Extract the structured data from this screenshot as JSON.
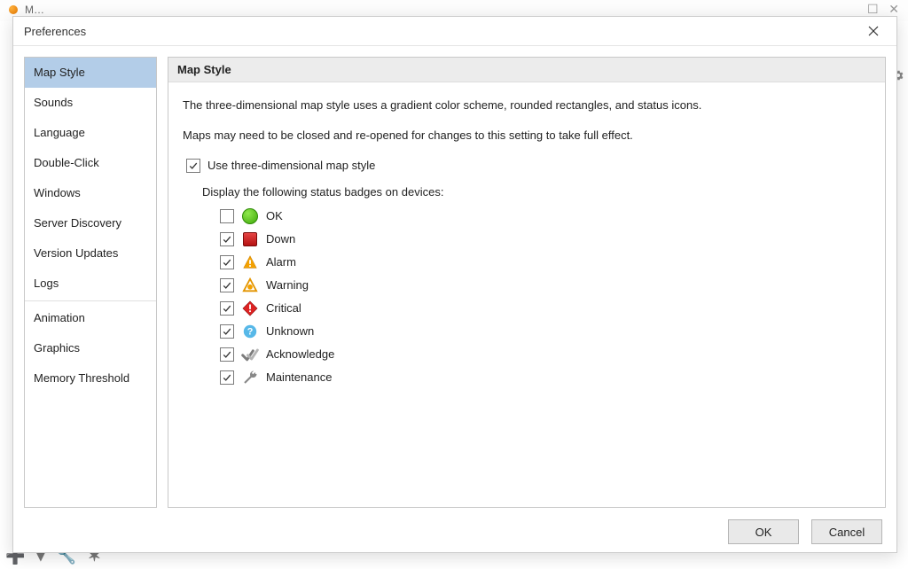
{
  "dialog_title": "Preferences",
  "bg_partial_title": "M… L:+…",
  "sidebar": {
    "items": [
      {
        "label": "Map Style",
        "selected": true
      },
      {
        "label": "Sounds",
        "selected": false
      },
      {
        "label": "Language",
        "selected": false
      },
      {
        "label": "Double-Click",
        "selected": false
      },
      {
        "label": "Windows",
        "selected": false
      },
      {
        "label": "Server Discovery",
        "selected": false
      },
      {
        "label": "Version Updates",
        "selected": false
      },
      {
        "label": "Logs",
        "selected": false
      },
      {
        "label": "Animation",
        "selected": false
      },
      {
        "label": "Graphics",
        "selected": false
      },
      {
        "label": "Memory Threshold",
        "selected": false
      }
    ],
    "separator_after_index": 7
  },
  "panel": {
    "title": "Map Style",
    "desc1": "The three-dimensional map style uses a gradient color scheme, rounded rectangles, and status icons.",
    "desc2": "Maps may need to be closed and re-opened for changes to this setting to take full effect.",
    "main_check": {
      "label": "Use three-dimensional map style",
      "checked": true
    },
    "badges_intro": "Display the following status badges on devices:",
    "badges": [
      {
        "label": "OK",
        "checked": false,
        "icon": "ok"
      },
      {
        "label": "Down",
        "checked": true,
        "icon": "down"
      },
      {
        "label": "Alarm",
        "checked": true,
        "icon": "alarm"
      },
      {
        "label": "Warning",
        "checked": true,
        "icon": "warning"
      },
      {
        "label": "Critical",
        "checked": true,
        "icon": "critical"
      },
      {
        "label": "Unknown",
        "checked": true,
        "icon": "unknown"
      },
      {
        "label": "Acknowledge",
        "checked": true,
        "icon": "ack"
      },
      {
        "label": "Maintenance",
        "checked": true,
        "icon": "wrench"
      }
    ]
  },
  "buttons": {
    "ok": "OK",
    "cancel": "Cancel"
  }
}
